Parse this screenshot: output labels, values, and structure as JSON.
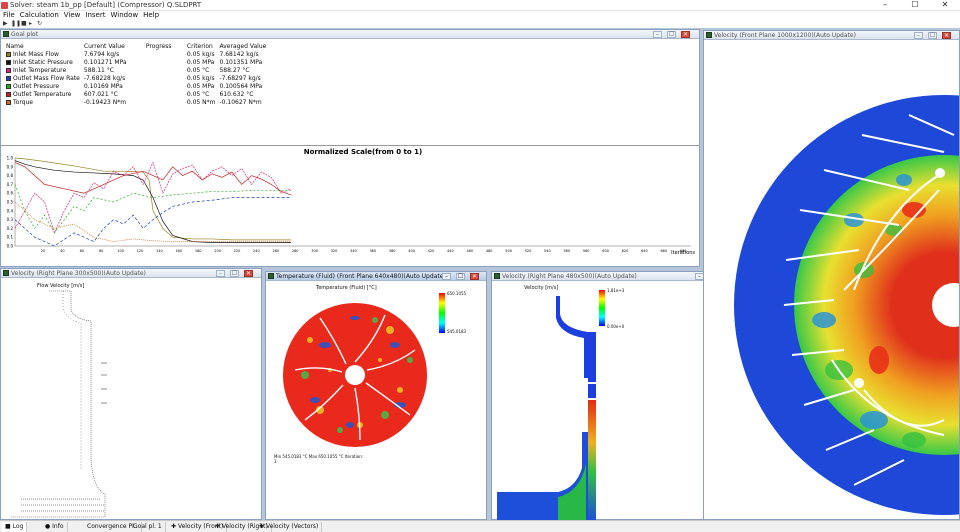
{
  "app": {
    "title": "Solver: steam 1b_pp [Default] (Compressor) Q.SLDPRT",
    "controls": [
      "–",
      "☐",
      "✕"
    ]
  },
  "menu": [
    "File",
    "Calculation",
    "View",
    "Insert",
    "Window",
    "Help"
  ],
  "goals_window": {
    "title": "Goal plot",
    "headers": [
      "Name",
      "Current Value",
      "Progress",
      "Criterion",
      "Averaged Value"
    ],
    "rows": [
      {
        "name": "Inlet Mass Flow",
        "color": "#9a8020",
        "current": "7.6794 kg/s",
        "progress": "",
        "criterion": "0.05 kg/s",
        "averaged": "7.68142 kg/s"
      },
      {
        "name": "Inlet Static Pressure",
        "color": "#111111",
        "current": "0.101271 MPa",
        "progress": "",
        "criterion": "0.05 MPa",
        "averaged": "0.101351 MPa"
      },
      {
        "name": "Inlet Temperature",
        "color": "#e0207a",
        "current": "588.11 °C",
        "progress": "",
        "criterion": "0.05 °C",
        "averaged": "588.27 °C"
      },
      {
        "name": "Outlet Mass Flow Rate",
        "color": "#1f3fbf",
        "current": "-7.68228 kg/s",
        "progress": "",
        "criterion": "0.05 kg/s",
        "averaged": "-7.68297 kg/s"
      },
      {
        "name": "Outlet Pressure",
        "color": "#22b022",
        "current": "0.10169 MPa",
        "progress": "",
        "criterion": "0.05 MPa",
        "averaged": "0.100564 MPa"
      },
      {
        "name": "Outlet Temperature",
        "color": "#c02020",
        "current": "607.021 °C",
        "progress": "",
        "criterion": "0.05 °C",
        "averaged": "610.632 °C"
      },
      {
        "name": "Torque",
        "color": "#d07020",
        "current": "-0.19423 N*m",
        "progress": "",
        "criterion": "0.05 N*m",
        "averaged": "-0.10627 N*m"
      }
    ]
  },
  "chart_data": {
    "type": "line",
    "title": "Normalized Scale(from 0 to 1)",
    "xlabel": "Iterations",
    "ylabel": "",
    "ylim": [
      0,
      1
    ],
    "y_ticks": [
      "1.0",
      "0.9",
      "0.8",
      "0.7",
      "0.6",
      "0.5",
      "0.4",
      "0.3",
      "0.2",
      "0.1",
      "0.0"
    ],
    "x_ticks": [
      "20",
      "40",
      "60",
      "80",
      "100",
      "120",
      "140",
      "160",
      "180",
      "200",
      "220",
      "240",
      "260",
      "280",
      "300",
      "320",
      "340",
      "360",
      "380",
      "400",
      "420",
      "440",
      "460",
      "480",
      "500",
      "520",
      "540",
      "560",
      "580",
      "600",
      "620",
      "640",
      "660",
      "680"
    ],
    "series": [
      {
        "color": "#9a8020",
        "dash": "",
        "x": [
          0,
          10,
          30,
          60,
          90,
          110,
          130,
          136,
          140,
          150,
          160,
          180,
          200,
          220,
          240,
          260,
          280
        ],
        "y": [
          1.0,
          0.99,
          0.96,
          0.91,
          0.85,
          0.85,
          0.84,
          0.75,
          0.4,
          0.2,
          0.1,
          0.08,
          0.08,
          0.07,
          0.07,
          0.07,
          0.07
        ]
      },
      {
        "color": "#111111",
        "dash": "",
        "x": [
          0,
          10,
          20,
          40,
          60,
          80,
          100,
          120,
          130,
          140,
          150,
          160,
          180,
          200,
          240,
          280
        ],
        "y": [
          0.97,
          0.93,
          0.9,
          0.86,
          0.84,
          0.83,
          0.82,
          0.8,
          0.75,
          0.55,
          0.28,
          0.12,
          0.05,
          0.04,
          0.04,
          0.04
        ]
      },
      {
        "color": "#e0207a",
        "dash": "2,1",
        "x": [
          0,
          20,
          30,
          40,
          50,
          60,
          70,
          80,
          90,
          100,
          110,
          120,
          130,
          140,
          150,
          160,
          170,
          180,
          190,
          200,
          210,
          220,
          230,
          240,
          250,
          260,
          270,
          280
        ],
        "y": [
          0.2,
          0.6,
          0.5,
          0.15,
          0.4,
          0.6,
          0.55,
          0.72,
          0.65,
          0.85,
          0.8,
          0.9,
          0.7,
          0.95,
          0.6,
          0.82,
          0.88,
          0.92,
          0.75,
          0.85,
          0.9,
          0.8,
          0.88,
          0.7,
          0.84,
          0.78,
          0.6,
          0.65
        ]
      },
      {
        "color": "#1f3fbf",
        "dash": "3,2",
        "x": [
          0,
          20,
          40,
          60,
          80,
          90,
          100,
          110,
          120,
          130,
          140,
          150,
          160,
          180,
          200,
          220,
          240,
          260,
          280
        ],
        "y": [
          0.3,
          0.1,
          0.0,
          0.15,
          0.05,
          0.2,
          0.3,
          0.25,
          0.35,
          0.2,
          0.3,
          0.38,
          0.45,
          0.5,
          0.52,
          0.55,
          0.55,
          0.55,
          0.55
        ]
      },
      {
        "color": "#22b022",
        "dash": "2,2",
        "x": [
          0,
          10,
          20,
          30,
          40,
          60,
          70,
          80,
          100,
          120,
          140,
          160,
          180,
          200,
          220,
          240,
          260,
          280
        ],
        "y": [
          0.7,
          0.4,
          0.2,
          0.35,
          0.15,
          0.45,
          0.4,
          0.55,
          0.5,
          0.6,
          0.55,
          0.58,
          0.6,
          0.62,
          0.62,
          0.63,
          0.63,
          0.63
        ]
      },
      {
        "color": "#c02020",
        "dash": "",
        "x": [
          0,
          10,
          20,
          30,
          50,
          70,
          90,
          110,
          130,
          150,
          160,
          170,
          180,
          190,
          200,
          210,
          220,
          230,
          240,
          250,
          260,
          270,
          280
        ],
        "y": [
          0.95,
          0.9,
          0.8,
          0.7,
          0.65,
          0.6,
          0.7,
          0.8,
          0.85,
          0.75,
          0.9,
          0.8,
          0.85,
          0.75,
          0.82,
          0.78,
          0.84,
          0.7,
          0.8,
          0.76,
          0.7,
          0.62,
          0.58
        ]
      },
      {
        "color": "#d07020",
        "dash": "1,1",
        "x": [
          0,
          20,
          40,
          60,
          80,
          100,
          120,
          140,
          160,
          180,
          200,
          220,
          240,
          260,
          280
        ],
        "y": [
          0.5,
          0.3,
          0.2,
          0.25,
          0.1,
          0.05,
          0.08,
          0.06,
          0.05,
          0.05,
          0.05,
          0.05,
          0.05,
          0.05,
          0.05
        ]
      }
    ]
  },
  "plot_windows": {
    "velocity_right_small": {
      "title": "Velocity (Right Plane 300x500)(Auto Update)",
      "caption": "Flow Velocity [m/s]"
    },
    "temperature_front": {
      "title": "Temperature (Fluid) (Front Plane 640x480)(Auto Update)",
      "caption": "Temperature (Fluid) [°C]",
      "legend_max": "650.1055",
      "legend_min": "545.0183",
      "footnote": "Min 545.0183 °C  Max 650.1055 °C  Iteration: 3"
    },
    "velocity_right_plane": {
      "title": "Velocity (Right Plane 480x500)(Auto Update)",
      "caption": "Velocity [m/s]",
      "legend_max": "1.81e+3",
      "legend_min": "0.00e+0"
    },
    "velocity_front_large": {
      "title": "Velocity (Front Plane 1000x1200)(Auto Update)"
    }
  },
  "status_tabs": [
    "Log",
    "Info",
    "Convergence Pl..",
    "Goal pl. 1",
    "Velocity (Front)",
    "Velocity (Right)",
    "Velocity (Vectors)"
  ]
}
